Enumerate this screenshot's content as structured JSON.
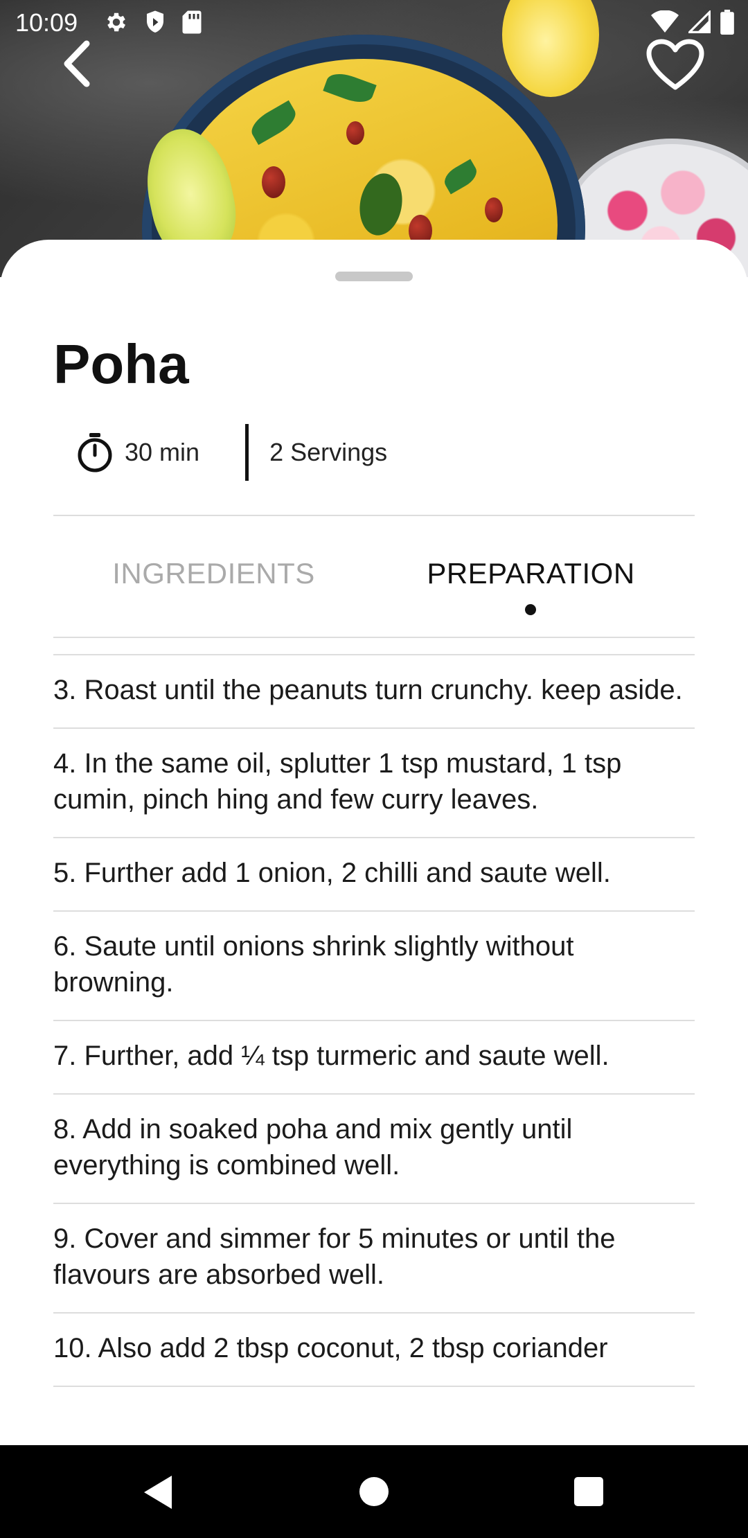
{
  "status_bar": {
    "time": "10:09",
    "left_icons": [
      "gear-icon",
      "shield-icon",
      "sd-card-icon"
    ],
    "right_icons": [
      "wifi-icon",
      "cell-signal-icon",
      "battery-icon"
    ]
  },
  "header": {
    "back_icon": "chevron-left-icon",
    "favorite_icon": "heart-outline-icon"
  },
  "recipe": {
    "title": "Poha",
    "time": "30 min",
    "servings": "2 Servings"
  },
  "tabs": [
    {
      "label": "INGREDIENTS",
      "selected": false
    },
    {
      "label": "PREPARATION",
      "selected": true
    }
  ],
  "steps": [
    "3. Roast until the peanuts turn crunchy. keep aside.",
    "4. In the same oil, splutter 1 tsp mustard, 1 tsp cumin, pinch hing and few curry leaves.",
    "5. Further add 1 onion, 2 chilli and saute well.",
    "6. Saute until onions shrink slightly without browning.",
    "7. Further, add ¼ tsp turmeric and saute well.",
    "8. Add in soaked poha and mix gently until everything is combined well.",
    "9. Cover and simmer for 5 minutes or until the flavours are absorbed well.",
    "10. Also add 2 tbsp coconut, 2 tbsp coriander"
  ],
  "nav_bar": {
    "back_icon": "nav-back-icon",
    "home_icon": "nav-home-icon",
    "recents_icon": "nav-recents-icon"
  },
  "colors": {
    "accent": "#111111",
    "inactive_tab": "#aaaaaa",
    "divider": "#dddddd",
    "background": "#ffffff"
  }
}
